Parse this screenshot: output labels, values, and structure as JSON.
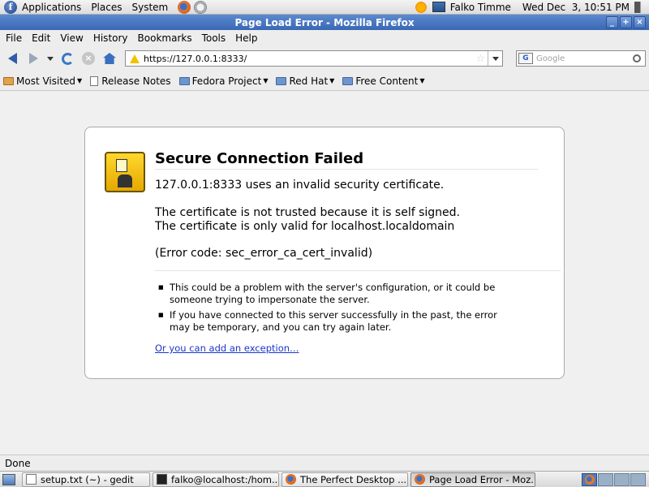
{
  "top_panel": {
    "menus": [
      "Applications",
      "Places",
      "System"
    ],
    "user": "Falko Timme",
    "clock": "Wed Dec  3, 10:51 PM"
  },
  "window": {
    "title": "Page Load Error - Mozilla Firefox",
    "controls": [
      "_",
      "+",
      "×"
    ]
  },
  "menubar": {
    "items": [
      {
        "key": "F",
        "rest": "ile"
      },
      {
        "key": "E",
        "rest": "dit"
      },
      {
        "key": "V",
        "rest": "iew"
      },
      {
        "key": "His",
        "rest": "tory",
        "under": "s"
      },
      {
        "key": "B",
        "rest": "ookmarks"
      },
      {
        "key": "T",
        "rest": "ools"
      },
      {
        "key": "H",
        "rest": "elp"
      }
    ],
    "labels": [
      "File",
      "Edit",
      "View",
      "History",
      "Bookmarks",
      "Tools",
      "Help"
    ]
  },
  "navbar": {
    "url": "https://127.0.0.1:8333/",
    "search_placeholder": "Google",
    "search_engine": "G"
  },
  "bookmarks": {
    "most_visited": "Most Visited",
    "release_notes": "Release Notes",
    "fedora_project": "Fedora Project",
    "red_hat": "Red Hat",
    "free_content": "Free Content"
  },
  "error": {
    "title": "Secure Connection Failed",
    "line1": "127.0.0.1:8333 uses an invalid security certificate.",
    "line2": "The certificate is not trusted because it is self signed.",
    "line3": "The certificate is only valid for localhost.localdomain",
    "line4": "(Error code: sec_error_ca_cert_invalid)",
    "bullet1": "This could be a problem with the server's configuration, or it could be someone trying to impersonate the server.",
    "bullet2": "If you have connected to this server successfully in the past, the error may be temporary, and you can try again later.",
    "exception_link": "Or you can add an exception…"
  },
  "statusbar": {
    "text": "Done"
  },
  "taskbar": {
    "tasks": [
      "setup.txt (~) - gedit",
      "falko@localhost:/hom...",
      "The Perfect Desktop ...",
      "Page Load Error - Moz..."
    ]
  },
  "colors": {
    "titlebar": "#3a67b3",
    "link": "#1a36c9",
    "warning": "#f2c200"
  }
}
